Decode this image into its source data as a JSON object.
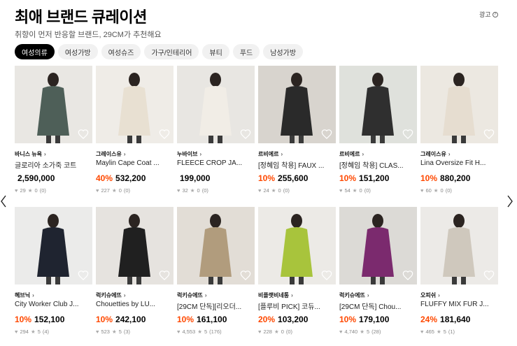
{
  "header": {
    "title": "최애 브랜드 큐레이션",
    "subtitle": "취향이 먼저 반응할 브랜드, 29CM가 추천해요",
    "ad_label": "광고",
    "ad_icon": "info-icon"
  },
  "tabs": [
    {
      "label": "여성의류",
      "active": true
    },
    {
      "label": "여성가방",
      "active": false
    },
    {
      "label": "여성슈즈",
      "active": false
    },
    {
      "label": "가구/인테리어",
      "active": false
    },
    {
      "label": "뷰티",
      "active": false
    },
    {
      "label": "푸드",
      "active": false
    },
    {
      "label": "남성가방",
      "active": false
    }
  ],
  "products": [
    {
      "brand": "바니스 뉴욕",
      "name": "글로리아 소가죽 코트",
      "discount": "",
      "price": "2,590,000",
      "likes": "29",
      "rating": "0",
      "reviews": "(0)",
      "bg": "#e9e7e3",
      "accent": "#4e5f58"
    },
    {
      "brand": "그레이스유",
      "name": "Maylin Cape Coat ...",
      "discount": "40%",
      "price": "532,200",
      "likes": "227",
      "rating": "0",
      "reviews": "(0)",
      "bg": "#efece7",
      "accent": "#e8e0d2"
    },
    {
      "brand": "누바이브",
      "name": "FLEECE CROP JA...",
      "discount": "",
      "price": "199,000",
      "likes": "32",
      "rating": "0",
      "reviews": "(0)",
      "bg": "#e8e6e2",
      "accent": "#f1ede6"
    },
    {
      "brand": "르비에르",
      "name": "[정혜임 착용] FAUX ...",
      "discount": "10%",
      "price": "255,600",
      "likes": "24",
      "rating": "0",
      "reviews": "(0)",
      "bg": "#d8d4ce",
      "accent": "#2a2a2a"
    },
    {
      "brand": "르비에르",
      "name": "[정혜임 착용] CLAS...",
      "discount": "10%",
      "price": "151,200",
      "likes": "54",
      "rating": "0",
      "reviews": "(0)",
      "bg": "#dfe1dc",
      "accent": "#2f2f2f"
    },
    {
      "brand": "그레이스유",
      "name": "Lina Oversize Fit H...",
      "discount": "10%",
      "price": "880,200",
      "likes": "60",
      "rating": "0",
      "reviews": "(0)",
      "bg": "#ece8e1",
      "accent": "#e6ddd0"
    },
    {
      "brand": "헤브닉",
      "name": "City Worker Club J...",
      "discount": "10%",
      "price": "152,100",
      "likes": "294",
      "rating": "5",
      "reviews": "(4)",
      "bg": "#ebebea",
      "accent": "#1f2430"
    },
    {
      "brand": "럭키슈에뜨",
      "name": "Chouetties by LU...",
      "discount": "10%",
      "price": "242,100",
      "likes": "523",
      "rating": "5",
      "reviews": "(3)",
      "bg": "#e6e3df",
      "accent": "#202020"
    },
    {
      "brand": "럭키슈에뜨",
      "name": "[29CM 단독][리오더...",
      "discount": "10%",
      "price": "161,100",
      "likes": "4,553",
      "rating": "5",
      "reviews": "(176)",
      "bg": "#e2ddd6",
      "accent": "#b19c7d"
    },
    {
      "brand": "비플랫비네통",
      "name": "[플루비 PICK] 코듀...",
      "discount": "20%",
      "price": "103,200",
      "likes": "228",
      "rating": "0",
      "reviews": "(0)",
      "bg": "#eceae6",
      "accent": "#a8c43c"
    },
    {
      "brand": "럭키슈에뜨",
      "name": "[29CM 단독] Chou...",
      "discount": "10%",
      "price": "179,100",
      "likes": "4,740",
      "rating": "5",
      "reviews": "(28)",
      "bg": "#dcdad6",
      "accent": "#7b2a6e"
    },
    {
      "brand": "오피쉬",
      "name": "FLUFFY MIX FUR J...",
      "discount": "24%",
      "price": "181,640",
      "likes": "465",
      "rating": "5",
      "reviews": "(1)",
      "bg": "#eceae7",
      "accent": "#cfc8bd"
    }
  ]
}
